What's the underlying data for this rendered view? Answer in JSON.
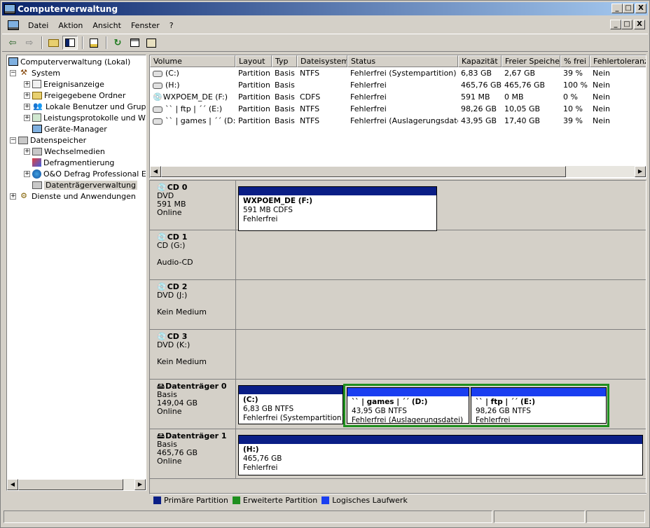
{
  "window": {
    "title": "Computerverwaltung",
    "min": "_",
    "max": "□",
    "close": "X"
  },
  "menu": {
    "items": [
      "Datei",
      "Aktion",
      "Ansicht",
      "Fenster",
      "?"
    ]
  },
  "toolbar": {
    "back": "⇦",
    "forward": "⇨"
  },
  "tree": {
    "nodes": [
      {
        "label": "Computerverwaltung (Lokal)",
        "icon": "computer-icon"
      },
      {
        "label": "System",
        "icon": "tools-icon"
      },
      {
        "label": "Ereignisanzeige",
        "icon": "event-viewer-icon"
      },
      {
        "label": "Freigegebene Ordner",
        "icon": "shared-folder-icon"
      },
      {
        "label": "Lokale Benutzer und Gruppen",
        "icon": "users-icon"
      },
      {
        "label": "Leistungsprotokolle und Warnungen",
        "icon": "performance-icon"
      },
      {
        "label": "Geräte-Manager",
        "icon": "device-manager-icon"
      },
      {
        "label": "Datenspeicher",
        "icon": "storage-icon"
      },
      {
        "label": "Wechselmedien",
        "icon": "removable-media-icon"
      },
      {
        "label": "Defragmentierung",
        "icon": "defrag-icon"
      },
      {
        "label": "O&O Defrag Professional Edition",
        "icon": "oo-defrag-icon"
      },
      {
        "label": "Datenträgerverwaltung",
        "icon": "disk-management-icon"
      },
      {
        "label": "Dienste und Anwendungen",
        "icon": "services-icon"
      }
    ]
  },
  "volumes": {
    "columns": [
      "Volume",
      "Layout",
      "Typ",
      "Dateisystem",
      "Status",
      "Kapazität",
      "Freier Speicher",
      "% frei",
      "Fehlertoleranz"
    ],
    "rows": [
      [
        "(C:)",
        "Partition",
        "Basis",
        "NTFS",
        "Fehlerfrei (Systempartition)",
        "6,83 GB",
        "2,67 GB",
        "39 %",
        "Nein"
      ],
      [
        "(H:)",
        "Partition",
        "Basis",
        "",
        "Fehlerfrei",
        "465,76 GB",
        "465,76 GB",
        "100 %",
        "Nein"
      ],
      [
        "WXPOEM_DE (F:)",
        "Partition",
        "Basis",
        "CDFS",
        "Fehlerfrei",
        "591 MB",
        "0 MB",
        "0 %",
        "Nein"
      ],
      [
        "`` |   ftp   | ´´ (E:)",
        "Partition",
        "Basis",
        "NTFS",
        "Fehlerfrei",
        "98,26 GB",
        "10,05 GB",
        "10 %",
        "Nein"
      ],
      [
        "`` | games | ´´ (D:)",
        "Partition",
        "Basis",
        "NTFS",
        "Fehlerfrei (Auslagerungsdatei)",
        "43,95 GB",
        "17,40 GB",
        "39 %",
        "Nein"
      ]
    ]
  },
  "disks": [
    {
      "name": "CD 0",
      "l1": "DVD",
      "l2": "591 MB",
      "l3": "Online",
      "parts": [
        {
          "title": "WXPOEM_DE  (F:)",
          "size": "591 MB CDFS",
          "status": "Fehlerfrei"
        }
      ]
    },
    {
      "name": "CD 1",
      "l1": "CD (G:)",
      "l2": "",
      "l3": "Audio-CD",
      "parts": []
    },
    {
      "name": "CD 2",
      "l1": "DVD (J:)",
      "l2": "",
      "l3": "Kein Medium",
      "parts": []
    },
    {
      "name": "CD 3",
      "l1": "DVD (K:)",
      "l2": "",
      "l3": "Kein Medium",
      "parts": []
    },
    {
      "name": "Datenträger 0",
      "l1": "Basis",
      "l2": "149,04 GB",
      "l3": "Online",
      "parts": [
        {
          "title": "(C:)",
          "size": "6,83 GB NTFS",
          "status": "Fehlerfrei (Systempartition)"
        },
        {
          "title": "`` | games | ´´  (D:)",
          "size": "43,95 GB NTFS",
          "status": "Fehlerfrei (Auslagerungsdatei)"
        },
        {
          "title": "`` |    ftp    | ´´  (E:)",
          "size": "98,26 GB NTFS",
          "status": "Fehlerfrei"
        }
      ]
    },
    {
      "name": "Datenträger 1",
      "l1": "Basis",
      "l2": "465,76 GB",
      "l3": "Online",
      "parts": [
        {
          "title": "(H:)",
          "size": "465,76 GB",
          "status": "Fehlerfrei"
        }
      ]
    }
  ],
  "legend": [
    {
      "label": "Primäre Partition",
      "color": "#0a1e86"
    },
    {
      "label": "Erweiterte Partition",
      "color": "#1f8f1f"
    },
    {
      "label": "Logisches Laufwerk",
      "color": "#1a3ef0"
    }
  ],
  "colors": {
    "primary": "#0a1e86",
    "extended": "#1f8f1f",
    "logical": "#1a3ef0",
    "titlebar": "#0a246a"
  }
}
